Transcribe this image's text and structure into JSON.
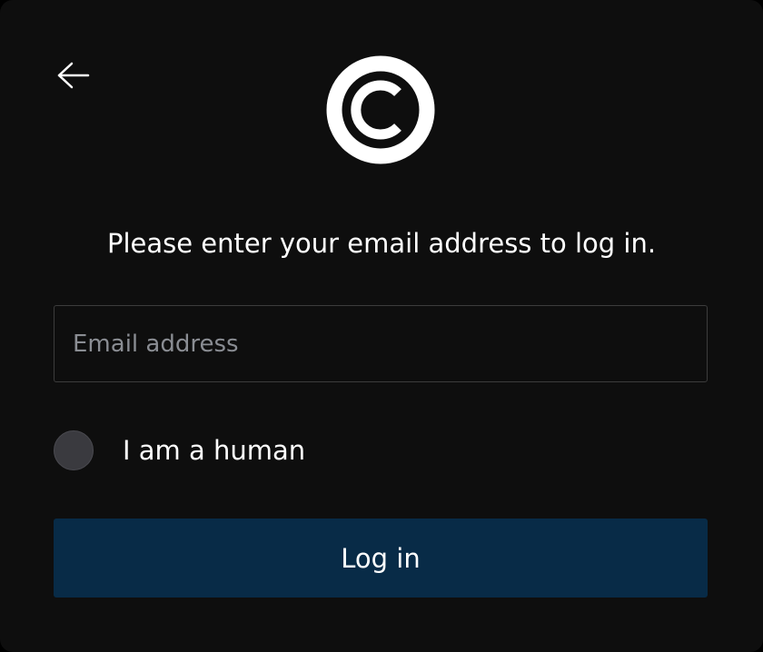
{
  "header": {
    "back_icon": "arrow-left-icon",
    "logo_icon": "copyright-icon"
  },
  "login": {
    "prompt": "Please enter your email address to log in.",
    "email_value": "",
    "email_placeholder": "Email address",
    "human_label": "I am a human",
    "human_checked": false,
    "button_label": "Log in"
  },
  "colors": {
    "background": "#0e0e0e",
    "text": "#ffffff",
    "placeholder": "#8a8d93",
    "input_border": "#3c3c3c",
    "radio_fill": "#3a3a3f",
    "button": "#082b47"
  }
}
